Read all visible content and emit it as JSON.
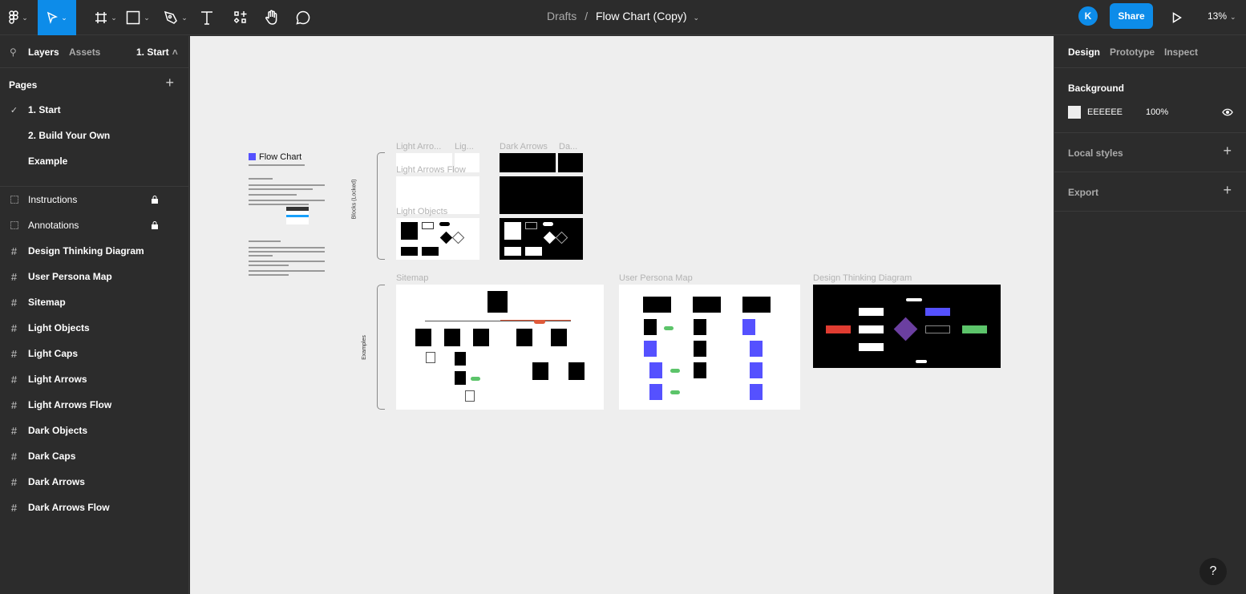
{
  "toolbar": {
    "tools": [
      "figma-menu",
      "move",
      "frame",
      "rectangle",
      "pen",
      "text",
      "components",
      "hand",
      "comment"
    ],
    "breadcrumb": {
      "parent": "Drafts",
      "separator": "/",
      "file": "Flow Chart (Copy)"
    },
    "avatar_initial": "K",
    "share_label": "Share",
    "zoom": "13%"
  },
  "left": {
    "tabs": {
      "layers": "Layers",
      "assets": "Assets",
      "page": "1. Start"
    },
    "pages_label": "Pages",
    "pages": [
      {
        "label": "1. Start",
        "current": true
      },
      {
        "label": "2. Build Your Own"
      },
      {
        "label": "Example"
      }
    ],
    "layers": [
      {
        "label": "Instructions",
        "type": "group",
        "locked": true
      },
      {
        "label": "Annotations",
        "type": "group",
        "locked": true
      },
      {
        "label": "Design Thinking Diagram",
        "type": "frame"
      },
      {
        "label": "User Persona Map",
        "type": "frame"
      },
      {
        "label": "Sitemap",
        "type": "frame"
      },
      {
        "label": "Light Objects",
        "type": "frame"
      },
      {
        "label": "Light Caps",
        "type": "frame"
      },
      {
        "label": "Light Arrows",
        "type": "frame"
      },
      {
        "label": "Light Arrows Flow",
        "type": "frame"
      },
      {
        "label": "Dark Objects",
        "type": "frame"
      },
      {
        "label": "Dark Caps",
        "type": "frame"
      },
      {
        "label": "Dark Arrows",
        "type": "frame"
      },
      {
        "label": "Dark Arrows Flow",
        "type": "frame"
      }
    ]
  },
  "right": {
    "tabs": [
      "Design",
      "Prototype",
      "Inspect"
    ],
    "background_label": "Background",
    "bg_hex": "EEEEEE",
    "bg_opacity": "100%",
    "local_styles": "Local styles",
    "export": "Export"
  },
  "canvas": {
    "background": "#EEEEEE",
    "doc_title": "Flow Chart",
    "blocks_label": "Blocks (Locked)",
    "examples_label": "Examples",
    "frames": {
      "light_arrows": "Light Arro...",
      "light_caps": "Lig...",
      "dark_arrows": "Dark Arrows",
      "dark_caps": "Da...",
      "light_arrows_flow": "Light Arrows Flow",
      "light_objects": "Light Objects",
      "sitemap": "Sitemap",
      "user_persona": "User Persona Map",
      "design_thinking": "Design Thinking Diagram"
    }
  },
  "help": "?",
  "colors": {
    "accent": "#0D8CE9",
    "purple": "#6B3FA0",
    "blue": "#5551FF",
    "green": "#5CC46A",
    "red": "#E03C31"
  }
}
